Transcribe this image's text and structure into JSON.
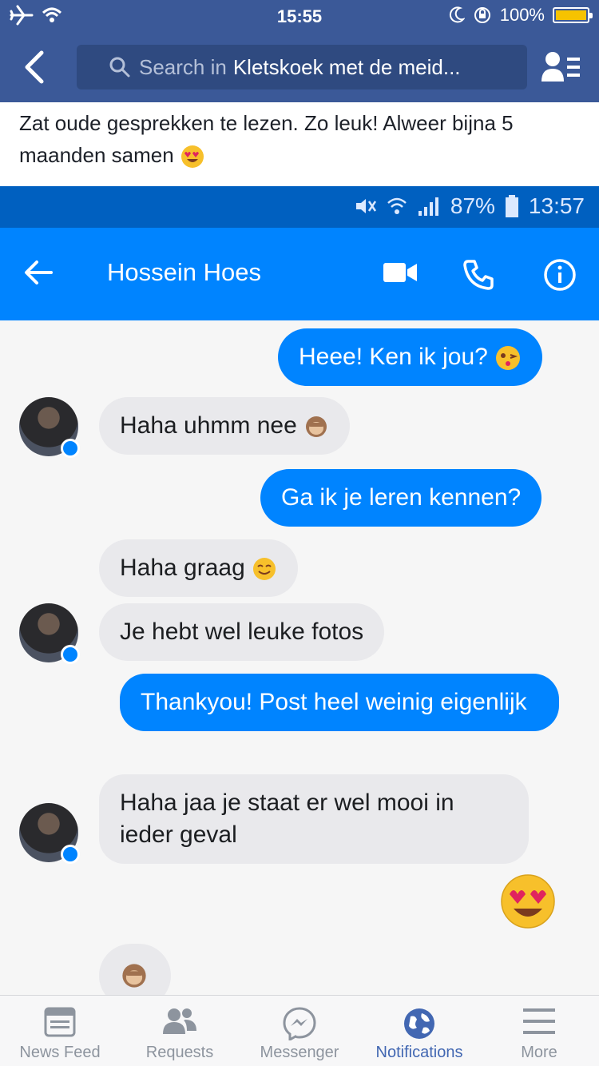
{
  "status_bar": {
    "time": "15:55",
    "battery": "100%"
  },
  "header": {
    "search_placeholder": "Search in",
    "search_scope": "Kletskoek met de meid..."
  },
  "post": {
    "line1": "Zat oude gesprekken te lezen. Zo leuk! Alweer bijna 5",
    "line2": "maanden samen"
  },
  "screenshot": {
    "android_status": {
      "battery": "87%",
      "time": "13:57"
    },
    "contact_name": "Hossein Hoes",
    "messages": [
      {
        "side": "out",
        "text": "Heee! Ken ik jou?"
      },
      {
        "side": "in",
        "text": "Haha uhmm nee"
      },
      {
        "side": "out",
        "text": "Ga ik je leren kennen?"
      },
      {
        "side": "in",
        "text": "Haha graag"
      },
      {
        "side": "in",
        "text": "Je hebt wel leuke fotos"
      },
      {
        "side": "out",
        "text": "Thankyou! Post heel weinig eigenlijk"
      },
      {
        "side": "in",
        "text": "Haha jaa je staat er wel mooi in ieder geval"
      }
    ]
  },
  "tabs": [
    {
      "label": "News Feed",
      "icon": "news-feed-icon",
      "active": false
    },
    {
      "label": "Requests",
      "icon": "friend-requests-icon",
      "active": false
    },
    {
      "label": "Messenger",
      "icon": "messenger-icon",
      "active": false
    },
    {
      "label": "Notifications",
      "icon": "globe-icon",
      "active": true
    },
    {
      "label": "More",
      "icon": "hamburger-menu-icon",
      "active": false
    }
  ],
  "colors": {
    "facebook_blue": "#3b5998",
    "messenger_blue": "#0084ff",
    "active_tab": "#4267b2"
  }
}
